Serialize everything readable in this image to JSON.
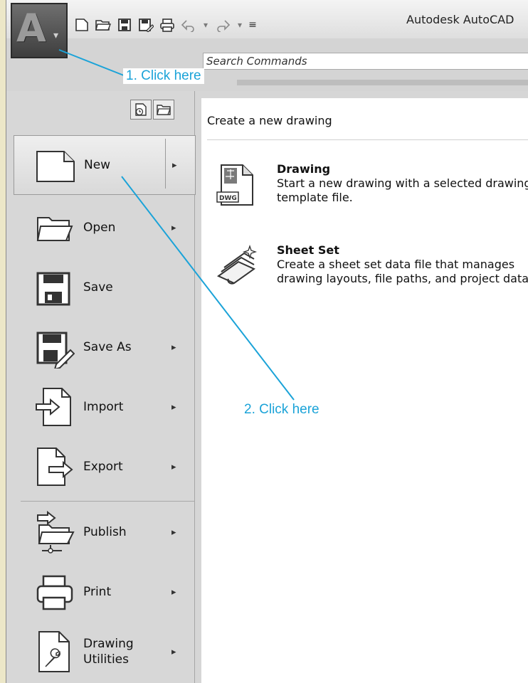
{
  "app": {
    "title": "Autodesk AutoCAD",
    "logo_letter": "A"
  },
  "search": {
    "placeholder": "Search Commands"
  },
  "menu": {
    "items": [
      {
        "id": "new",
        "label": "New",
        "has_submenu": true,
        "selected": true
      },
      {
        "id": "open",
        "label": "Open",
        "has_submenu": true
      },
      {
        "id": "save",
        "label": "Save",
        "has_submenu": false
      },
      {
        "id": "save-as",
        "label": "Save As",
        "has_submenu": true
      },
      {
        "id": "import",
        "label": "Import",
        "has_submenu": true
      },
      {
        "id": "export",
        "label": "Export",
        "has_submenu": true
      },
      {
        "id": "publish",
        "label": "Publish",
        "has_submenu": true
      },
      {
        "id": "print",
        "label": "Print",
        "has_submenu": true
      },
      {
        "id": "drawing-utilities",
        "label": "Drawing\nUtilities",
        "has_submenu": true
      }
    ],
    "arrow": "▸"
  },
  "panel": {
    "heading": "Create a new drawing",
    "options": [
      {
        "title": "Drawing",
        "description": "Start a new drawing with a selected drawing template file.",
        "icon_tag": "DWG"
      },
      {
        "title": "Sheet Set",
        "description": "Create a sheet set data file that manages drawing layouts, file paths, and project data."
      }
    ]
  },
  "callouts": {
    "step1": "1. Click here",
    "step2": "2. Click here"
  },
  "colors": {
    "callout": "#1ba3d8"
  }
}
